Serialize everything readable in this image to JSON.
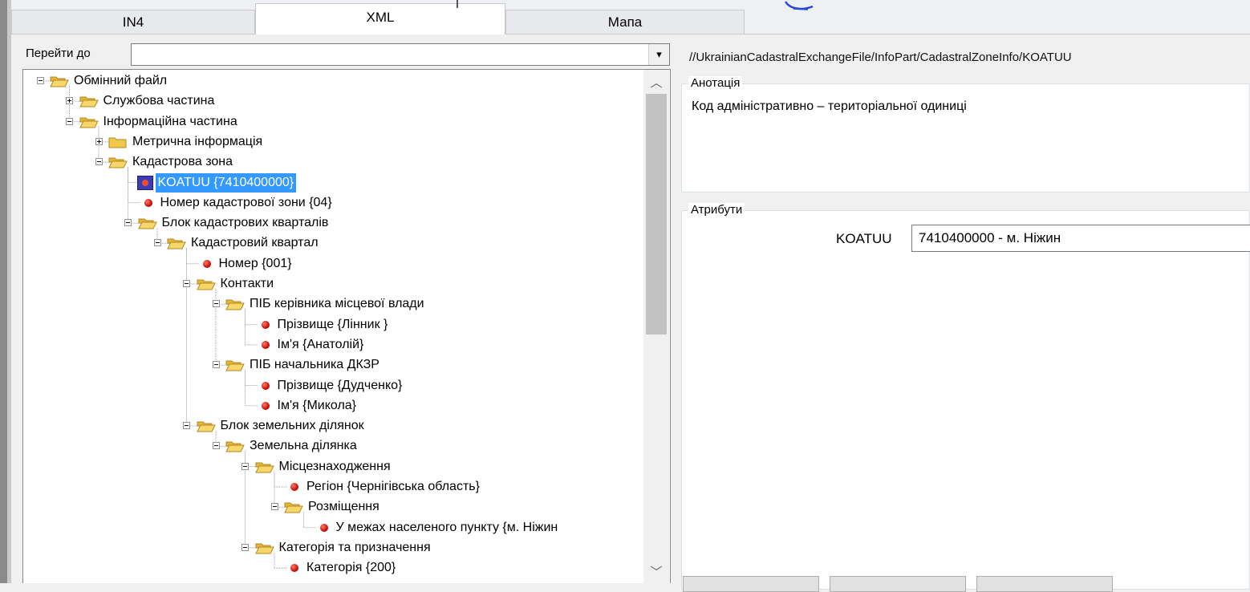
{
  "tabs": [
    {
      "label": "IN4",
      "active": false
    },
    {
      "label": "XML",
      "active": true
    },
    {
      "label": "Мапа",
      "active": false
    }
  ],
  "goto": {
    "label": "Перейти до",
    "value": "",
    "arrow": "▾"
  },
  "tree": {
    "items": [
      {
        "label": "Обмінний файл",
        "icon": "folder-open-icon",
        "toggle": "minus"
      },
      {
        "label": "Службова частина",
        "icon": "folder-open-icon",
        "toggle": "plus"
      },
      {
        "label": "Інформаційна частина",
        "icon": "folder-open-icon",
        "toggle": "minus"
      },
      {
        "label": "Метрична інформація",
        "icon": "folder-closed-icon",
        "toggle": "plus"
      },
      {
        "label": "Кадастрова зона",
        "icon": "folder-open-icon",
        "toggle": "minus"
      },
      {
        "label": "KOATUU {7410400000}",
        "icon": "attribute-icon",
        "selected": true
      },
      {
        "label": "Номер кадастрової зони {04}",
        "icon": "attribute-icon"
      },
      {
        "label": "Блок кадастрових кварталів",
        "icon": "folder-open-icon",
        "toggle": "minus"
      },
      {
        "label": "Кадастровий квартал",
        "icon": "folder-open-icon",
        "toggle": "minus"
      },
      {
        "label": "Номер {001}",
        "icon": "attribute-icon"
      },
      {
        "label": "Контакти",
        "icon": "folder-open-icon",
        "toggle": "minus"
      },
      {
        "label": "ПІБ керівника місцевої влади",
        "icon": "folder-open-icon",
        "toggle": "minus"
      },
      {
        "label": "Прізвище {Лінник }",
        "icon": "attribute-icon"
      },
      {
        "label": "Ім'я {Анатолій}",
        "icon": "attribute-icon"
      },
      {
        "label": "ПІБ начальника ДКЗР",
        "icon": "folder-open-icon",
        "toggle": "minus"
      },
      {
        "label": "Прізвище {Дудченко}",
        "icon": "attribute-icon"
      },
      {
        "label": "Ім'я {Микола}",
        "icon": "attribute-icon"
      },
      {
        "label": "Блок земельних ділянок",
        "icon": "folder-open-icon",
        "toggle": "minus"
      },
      {
        "label": "Земельна ділянка",
        "icon": "folder-open-icon",
        "toggle": "minus"
      },
      {
        "label": "Місцезнаходження",
        "icon": "folder-open-icon",
        "toggle": "minus"
      },
      {
        "label": "Регіон {Чернігівська область}",
        "icon": "attribute-icon"
      },
      {
        "label": "Розміщення",
        "icon": "folder-open-icon",
        "toggle": "minus"
      },
      {
        "label": "У межах населеного пункту {м. Ніжин",
        "icon": "attribute-icon"
      },
      {
        "label": "Категорія та призначення",
        "icon": "folder-open-icon",
        "toggle": "minus"
      },
      {
        "label": "Категорія {200}",
        "icon": "attribute-icon"
      }
    ]
  },
  "details": {
    "xpath": "//UkrainianCadastralExchangeFile/InfoPart/CadastralZoneInfo/KOATUU",
    "annotation": {
      "title": "Анотація",
      "text": "Код адміністративно – територіальної одиниці"
    },
    "attributes": {
      "title": "Атрибути",
      "label": "KOATUU",
      "value": "7410400000 - м. Ніжин"
    }
  },
  "colors": {
    "selection": "#3399ff",
    "folder": "#f3c74b",
    "attribute_dot": "#c9100a"
  }
}
